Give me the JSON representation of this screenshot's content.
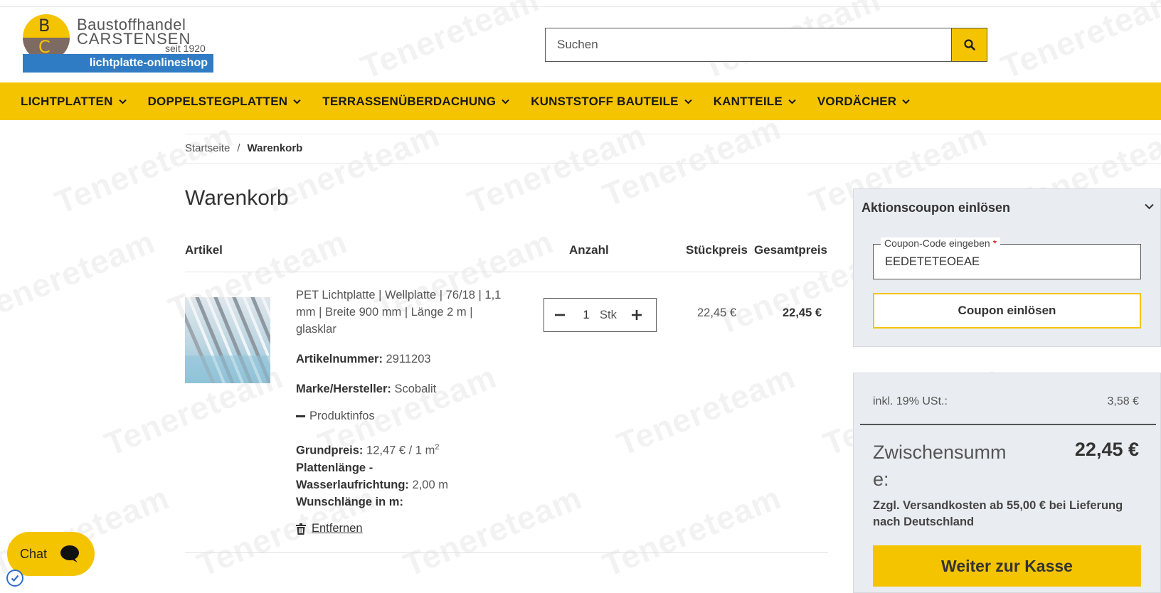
{
  "logo": {
    "line1": "Baustoffhandel",
    "line2": "CARSTENSEN",
    "since": "seit 1920",
    "shop": "lichtplatte-onlineshop",
    "letter_b": "B",
    "letter_c": "C"
  },
  "search": {
    "placeholder": "Suchen",
    "icon": "search-icon"
  },
  "nav": [
    {
      "label": "LICHTPLATTEN"
    },
    {
      "label": "DOPPELSTEGPLATTEN"
    },
    {
      "label": "TERRASSENÜBERDACHUNG"
    },
    {
      "label": "KUNSTSTOFF BAUTEILE"
    },
    {
      "label": "KANTTEILE"
    },
    {
      "label": "VORDÄCHER"
    }
  ],
  "breadcrumb": {
    "home": "Startseite",
    "sep": "/",
    "current": "Warenkorb"
  },
  "page_title": "Warenkorb",
  "table": {
    "col_article": "Artikel",
    "col_qty": "Anzahl",
    "col_unit_price": "Stückpreis",
    "col_total": "Gesamtpreis"
  },
  "item": {
    "title": "PET Lichtplatte | Wellplatte | 76/18 | 1,1 mm | Breite 900 mm | Länge 2 m | glasklar",
    "sku_label": "Artikelnummer:",
    "sku": "2911203",
    "brand_label": "Marke/Hersteller:",
    "brand": "Scobalit",
    "infos": "Produktinfos",
    "base_price_label": "Grundpreis:",
    "base_price": "12,47 € / 1 m",
    "base_price_unit_sup": "2",
    "length_label": "Plattenlänge - Wasserlaufrichtung:",
    "length_value": "2,00 m",
    "wish_label": "Wunschlänge in m:",
    "remove": "Entfernen",
    "quantity": "1",
    "unit": "Stk",
    "unit_price": "22,45 €",
    "total_price": "22,45 €"
  },
  "coupon": {
    "heading": "Aktionscoupon einlösen",
    "field_label": "Coupon-Code eingeben",
    "required_mark": "*",
    "value": "EEDETETEOEAE",
    "button": "Coupon einlösen"
  },
  "summary": {
    "tax_label": "inkl. 19% USt.:",
    "tax_value": "3,58 €",
    "subtotal_label": "Zwischensumme:",
    "subtotal_value": "22,45 €",
    "shipping_note": "Zzgl. Versandkosten ab 55,00 € bei Lieferung nach Deutschland",
    "checkout_button": "Weiter zur Kasse"
  },
  "chat": {
    "label": "Chat"
  },
  "watermark": "Tenereteam",
  "colors": {
    "brand_yellow": "#f5c400",
    "logo_blue": "#2f7cc4"
  }
}
